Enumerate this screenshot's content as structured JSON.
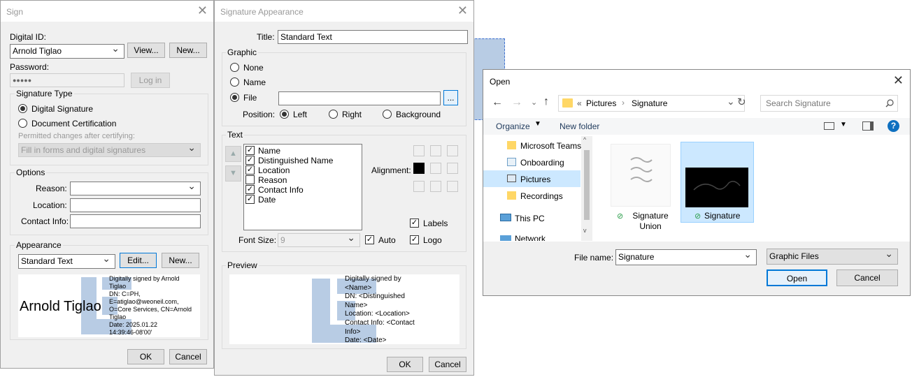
{
  "sign": {
    "title": "Sign",
    "digital_id_label": "Digital ID:",
    "digital_id_value": "Arnold Tiglao",
    "view_btn": "View...",
    "new_btn": "New...",
    "password_label": "Password:",
    "password_value": "●●●●●",
    "login_btn": "Log in",
    "sig_type_group": "Signature Type",
    "digital_signature": "Digital Signature",
    "document_cert": "Document Certification",
    "permitted_label": "Permitted changes after certifying:",
    "permitted_value": "Fill in forms and digital signatures",
    "options_group": "Options",
    "reason_label": "Reason:",
    "location_label": "Location:",
    "contact_label": "Contact Info:",
    "appearance_group": "Appearance",
    "appearance_value": "Standard Text",
    "edit_btn": "Edit...",
    "new2_btn": "New...",
    "sig_name": "Arnold Tiglao",
    "sig_lines": [
      "Digitally signed by Arnold",
      "Tiglao",
      "DN: C=PH,",
      "E=atiglao@weoneil.com,",
      "O=Core Services, CN=Arnold",
      "Tiglao",
      "Date: 2025.01.22",
      "14:39:46-08'00'"
    ],
    "ok": "OK",
    "cancel": "Cancel"
  },
  "appearance": {
    "title": "Signature Appearance",
    "title_label": "Title:",
    "title_value": "Standard Text",
    "graphic_group": "Graphic",
    "none": "None",
    "name": "Name",
    "file": "File",
    "browse": "...",
    "position_label": "Position:",
    "left": "Left",
    "right": "Right",
    "background": "Background",
    "text_group": "Text",
    "items": [
      {
        "label": "Name",
        "checked": true
      },
      {
        "label": "Distinguished Name",
        "checked": true
      },
      {
        "label": "Location",
        "checked": true
      },
      {
        "label": "Reason",
        "checked": false
      },
      {
        "label": "Contact Info",
        "checked": true
      },
      {
        "label": "Date",
        "checked": true
      }
    ],
    "alignment_label": "Alignment:",
    "labels": "Labels",
    "font_size_label": "Font Size:",
    "font_size_value": "9",
    "auto": "Auto",
    "logo": "Logo",
    "preview_group": "Preview",
    "preview_lines": [
      "Digitally signed by",
      "<Name>",
      "DN: <Distinguished",
      "Name>",
      "Location: <Location>",
      "Contact Info: <Contact",
      "Info>",
      "Date: <Date>"
    ],
    "ok": "OK",
    "cancel": "Cancel"
  },
  "open": {
    "title": "Open",
    "path_prefix": "«",
    "path": [
      "Pictures",
      "Signature"
    ],
    "search_placeholder": "Search Signature",
    "organize": "Organize",
    "new_folder": "New folder",
    "nav": [
      "Microsoft Teams",
      "Onboarding",
      "Pictures",
      "Recordings",
      "This PC",
      "Network"
    ],
    "files": [
      {
        "name": "Signature Union"
      },
      {
        "name": "Signature"
      }
    ],
    "file_name_label": "File name:",
    "file_name_value": "Signature",
    "filter_value": "Graphic Files",
    "open_btn": "Open",
    "cancel_btn": "Cancel"
  },
  "colors": {
    "accent": "#0078d7",
    "selection": "#cce8ff",
    "logo_blue": "#b8cce4"
  }
}
